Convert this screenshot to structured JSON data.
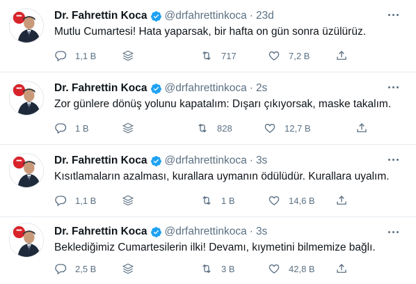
{
  "accent": "#1da1f2",
  "text_color": "#0f1419",
  "muted_color": "#5b7083",
  "tweets": [
    {
      "name": "Dr. Fahrettin Koca",
      "handle": "@drfahrettinkoca",
      "dot": "·",
      "time": "23d",
      "text": "Mutlu Cumartesi! Hata yaparsak, bir hafta on gün sonra üzülürüz.",
      "replies": "1,1 B",
      "retweets": "717",
      "likes": "7,2 B"
    },
    {
      "name": "Dr. Fahrettin Koca",
      "handle": "@drfahrettinkoca",
      "dot": "·",
      "time": "2s",
      "text": "Zor günlere dönüş yolunu kapatalım: Dışarı çıkıyorsak, maske takalım.",
      "replies": "1 B",
      "retweets": "828",
      "likes": "12,7 B"
    },
    {
      "name": "Dr. Fahrettin Koca",
      "handle": "@drfahrettinkoca",
      "dot": "·",
      "time": "3s",
      "text": "Kısıtlamaların azalması, kurallara uymanın ödülüdür. Kurallara uyalım.",
      "replies": "1,1 B",
      "retweets": "1 B",
      "likes": "14,6 B"
    },
    {
      "name": "Dr. Fahrettin Koca",
      "handle": "@drfahrettinkoca",
      "dot": "·",
      "time": "3s",
      "text": "Beklediğimiz Cumartesilerin ilki! Devamı, kıymetini bilmemize bağlı.",
      "replies": "2,5 B",
      "retweets": "3 B",
      "likes": "42,8 B"
    }
  ],
  "icons": {
    "avatar": "profile-photo",
    "verified": "verified-badge-icon",
    "more": "more-options-icon",
    "reply": "reply-icon",
    "fleet": "stack-icon",
    "retweet": "retweet-icon",
    "like": "heart-icon",
    "share": "share-icon"
  }
}
